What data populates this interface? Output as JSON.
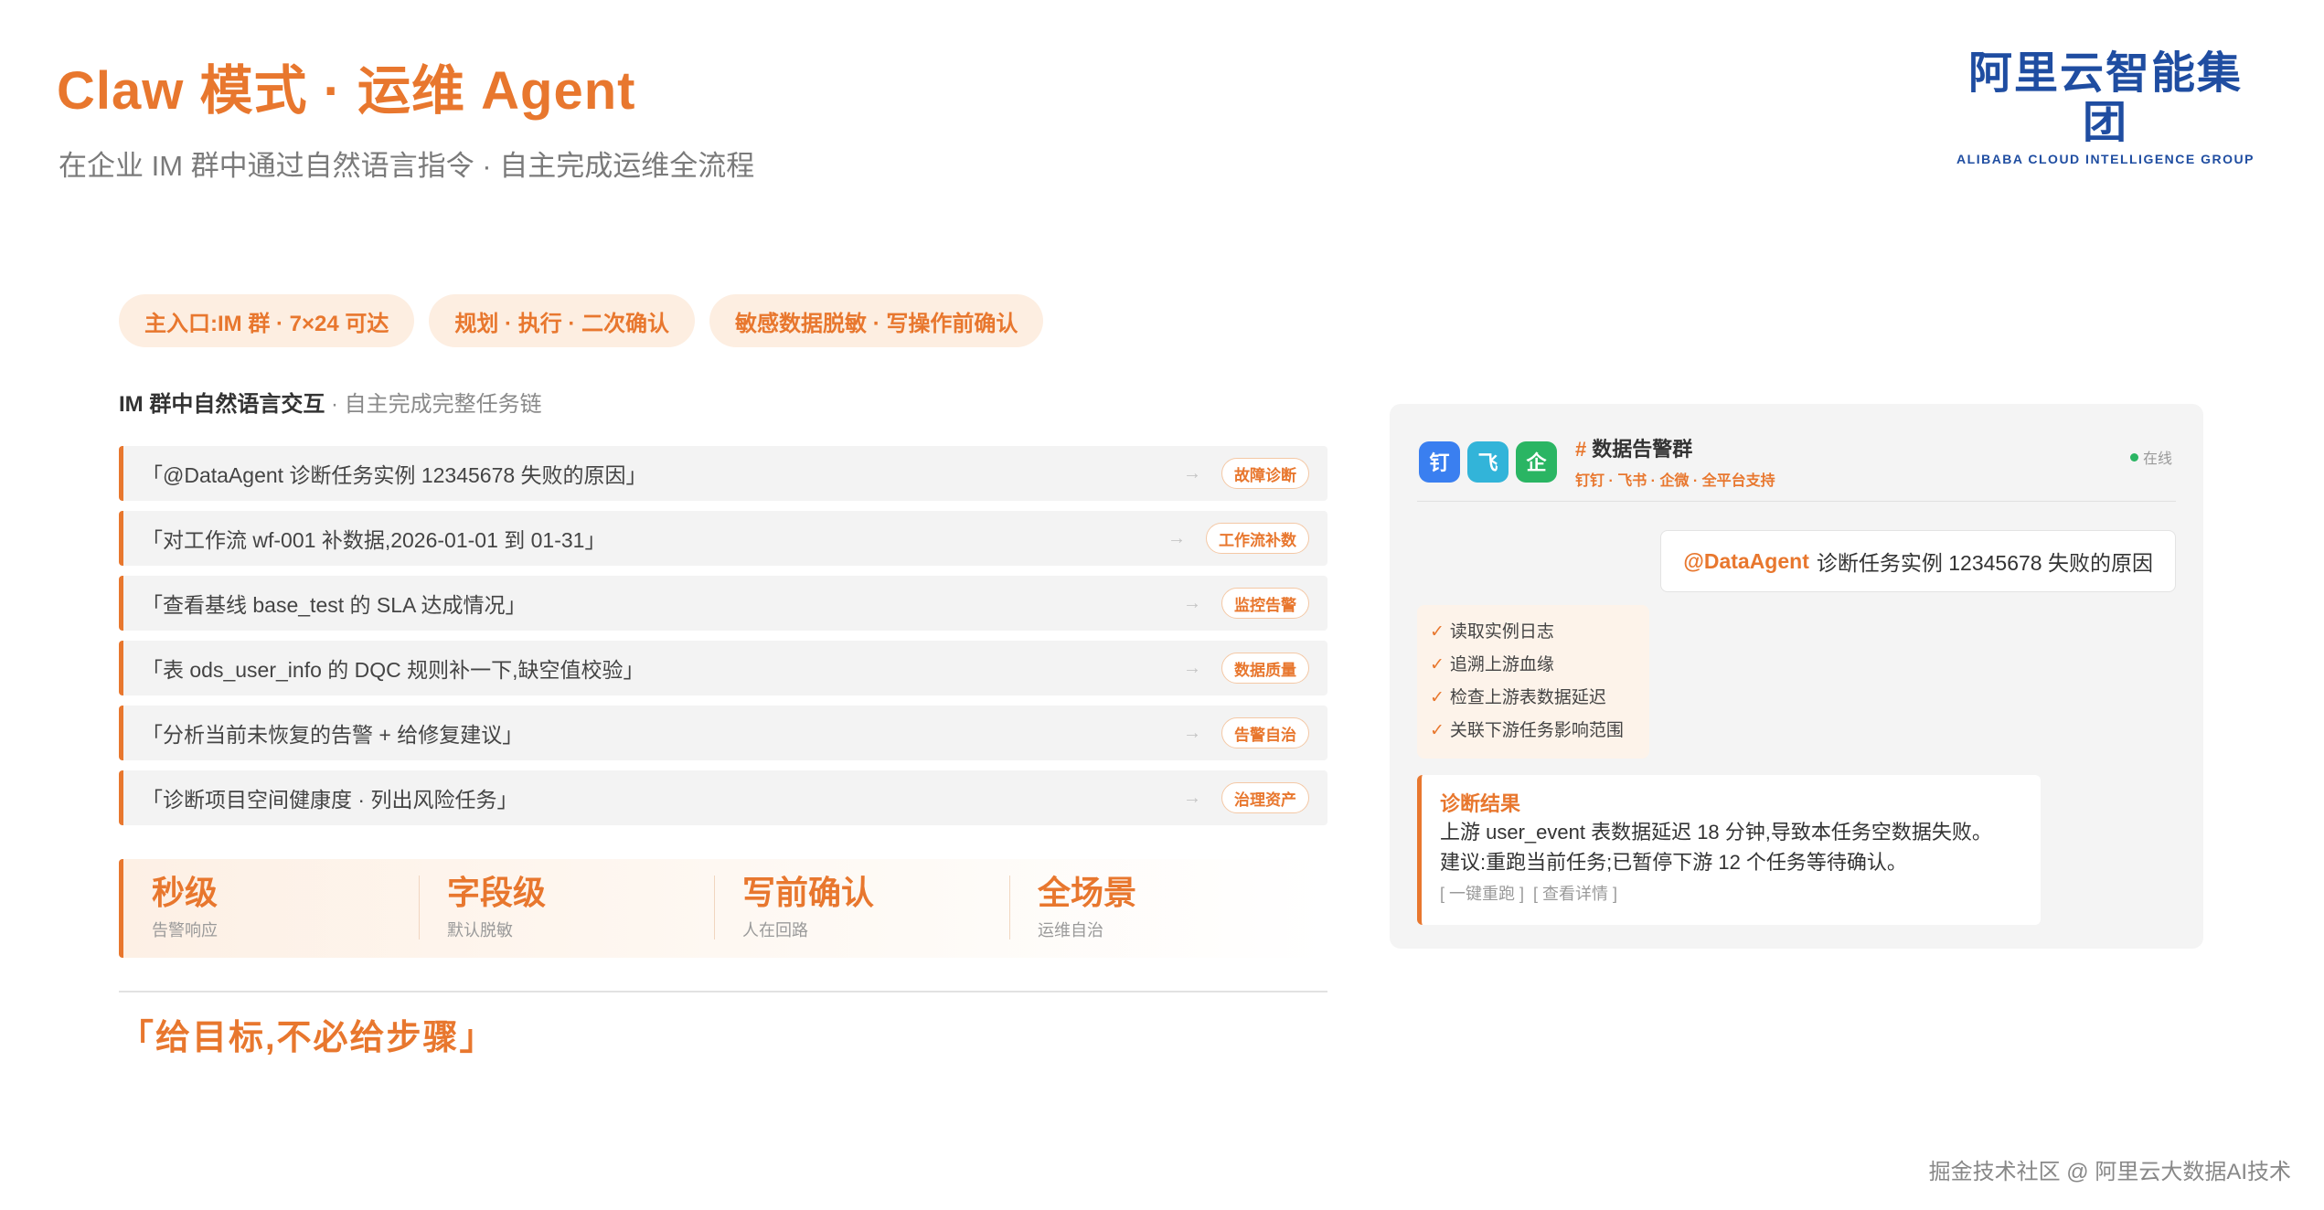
{
  "header": {
    "title": "Claw 模式 · 运维 Agent",
    "subtitle": "在企业 IM 群中通过自然语言指令 · 自主完成运维全流程"
  },
  "logo": {
    "cn": "阿里云智能集团",
    "en": "ALIBABA CLOUD INTELLIGENCE GROUP"
  },
  "pills": [
    "主入口:IM 群 · 7×24 可达",
    "规划 · 执行 · 二次确认",
    "敏感数据脱敏 · 写操作前确认"
  ],
  "section": {
    "bold": "IM 群中自然语言交互",
    "rest": " · 自主完成完整任务链"
  },
  "commands": [
    {
      "text": "「@DataAgent 诊断任务实例 12345678 失败的原因」",
      "arrow": "→",
      "tag": "故障诊断"
    },
    {
      "text": "「对工作流 wf-001 补数据,2026-01-01 到 01-31」",
      "arrow": "→",
      "tag": "工作流补数"
    },
    {
      "text": "「查看基线 base_test 的 SLA 达成情况」",
      "arrow": "→",
      "tag": "监控告警"
    },
    {
      "text": "「表 ods_user_info 的 DQC 规则补一下,缺空值校验」",
      "arrow": "→",
      "tag": "数据质量"
    },
    {
      "text": "「分析当前未恢复的告警 + 给修复建议」",
      "arrow": "→",
      "tag": "告警自治"
    },
    {
      "text": "「诊断项目空间健康度 · 列出风险任务」",
      "arrow": "→",
      "tag": "治理资产"
    }
  ],
  "stats": [
    {
      "value": "秒级",
      "label": "告警响应"
    },
    {
      "value": "字段级",
      "label": "默认脱敏"
    },
    {
      "value": "写前确认",
      "label": "人在回路"
    },
    {
      "value": "全场景",
      "label": "运维自治"
    }
  ],
  "slogan": "「给目标,不必给步骤」",
  "chat": {
    "icons": [
      "钉",
      "飞",
      "企"
    ],
    "group_hash": "#",
    "group_name": "数据告警群",
    "group_sub": "钉钉 · 飞书 · 企微 · 全平台支持",
    "status": "在线",
    "user_mention": "@DataAgent",
    "user_message": "诊断任务实例 12345678 失败的原因",
    "check_mark": "✓",
    "steps": [
      "读取实例日志",
      "追溯上游血缘",
      "检查上游表数据延迟",
      "关联下游任务影响范围"
    ],
    "result_title": "诊断结果",
    "result_lines": [
      "上游 user_event 表数据延迟 18 分钟,导致本任务空数据失败。",
      "建议:重跑当前任务;已暂停下游 12 个任务等待确认。"
    ],
    "actions": [
      "[ 一键重跑 ]",
      "[ 查看详情 ]"
    ]
  },
  "watermark": "掘金技术社区 @ 阿里云大数据AI技术"
}
